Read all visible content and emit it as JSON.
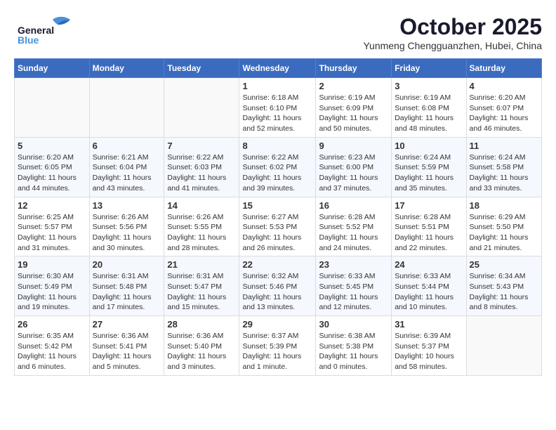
{
  "header": {
    "logo_general": "General",
    "logo_blue": "Blue",
    "month": "October 2025",
    "location": "Yunmeng Chengguanzhen, Hubei, China"
  },
  "weekdays": [
    "Sunday",
    "Monday",
    "Tuesday",
    "Wednesday",
    "Thursday",
    "Friday",
    "Saturday"
  ],
  "weeks": [
    [
      {
        "day": "",
        "info": ""
      },
      {
        "day": "",
        "info": ""
      },
      {
        "day": "",
        "info": ""
      },
      {
        "day": "1",
        "info": "Sunrise: 6:18 AM\nSunset: 6:10 PM\nDaylight: 11 hours\nand 52 minutes."
      },
      {
        "day": "2",
        "info": "Sunrise: 6:19 AM\nSunset: 6:09 PM\nDaylight: 11 hours\nand 50 minutes."
      },
      {
        "day": "3",
        "info": "Sunrise: 6:19 AM\nSunset: 6:08 PM\nDaylight: 11 hours\nand 48 minutes."
      },
      {
        "day": "4",
        "info": "Sunrise: 6:20 AM\nSunset: 6:07 PM\nDaylight: 11 hours\nand 46 minutes."
      }
    ],
    [
      {
        "day": "5",
        "info": "Sunrise: 6:20 AM\nSunset: 6:05 PM\nDaylight: 11 hours\nand 44 minutes."
      },
      {
        "day": "6",
        "info": "Sunrise: 6:21 AM\nSunset: 6:04 PM\nDaylight: 11 hours\nand 43 minutes."
      },
      {
        "day": "7",
        "info": "Sunrise: 6:22 AM\nSunset: 6:03 PM\nDaylight: 11 hours\nand 41 minutes."
      },
      {
        "day": "8",
        "info": "Sunrise: 6:22 AM\nSunset: 6:02 PM\nDaylight: 11 hours\nand 39 minutes."
      },
      {
        "day": "9",
        "info": "Sunrise: 6:23 AM\nSunset: 6:00 PM\nDaylight: 11 hours\nand 37 minutes."
      },
      {
        "day": "10",
        "info": "Sunrise: 6:24 AM\nSunset: 5:59 PM\nDaylight: 11 hours\nand 35 minutes."
      },
      {
        "day": "11",
        "info": "Sunrise: 6:24 AM\nSunset: 5:58 PM\nDaylight: 11 hours\nand 33 minutes."
      }
    ],
    [
      {
        "day": "12",
        "info": "Sunrise: 6:25 AM\nSunset: 5:57 PM\nDaylight: 11 hours\nand 31 minutes."
      },
      {
        "day": "13",
        "info": "Sunrise: 6:26 AM\nSunset: 5:56 PM\nDaylight: 11 hours\nand 30 minutes."
      },
      {
        "day": "14",
        "info": "Sunrise: 6:26 AM\nSunset: 5:55 PM\nDaylight: 11 hours\nand 28 minutes."
      },
      {
        "day": "15",
        "info": "Sunrise: 6:27 AM\nSunset: 5:53 PM\nDaylight: 11 hours\nand 26 minutes."
      },
      {
        "day": "16",
        "info": "Sunrise: 6:28 AM\nSunset: 5:52 PM\nDaylight: 11 hours\nand 24 minutes."
      },
      {
        "day": "17",
        "info": "Sunrise: 6:28 AM\nSunset: 5:51 PM\nDaylight: 11 hours\nand 22 minutes."
      },
      {
        "day": "18",
        "info": "Sunrise: 6:29 AM\nSunset: 5:50 PM\nDaylight: 11 hours\nand 21 minutes."
      }
    ],
    [
      {
        "day": "19",
        "info": "Sunrise: 6:30 AM\nSunset: 5:49 PM\nDaylight: 11 hours\nand 19 minutes."
      },
      {
        "day": "20",
        "info": "Sunrise: 6:31 AM\nSunset: 5:48 PM\nDaylight: 11 hours\nand 17 minutes."
      },
      {
        "day": "21",
        "info": "Sunrise: 6:31 AM\nSunset: 5:47 PM\nDaylight: 11 hours\nand 15 minutes."
      },
      {
        "day": "22",
        "info": "Sunrise: 6:32 AM\nSunset: 5:46 PM\nDaylight: 11 hours\nand 13 minutes."
      },
      {
        "day": "23",
        "info": "Sunrise: 6:33 AM\nSunset: 5:45 PM\nDaylight: 11 hours\nand 12 minutes."
      },
      {
        "day": "24",
        "info": "Sunrise: 6:33 AM\nSunset: 5:44 PM\nDaylight: 11 hours\nand 10 minutes."
      },
      {
        "day": "25",
        "info": "Sunrise: 6:34 AM\nSunset: 5:43 PM\nDaylight: 11 hours\nand 8 minutes."
      }
    ],
    [
      {
        "day": "26",
        "info": "Sunrise: 6:35 AM\nSunset: 5:42 PM\nDaylight: 11 hours\nand 6 minutes."
      },
      {
        "day": "27",
        "info": "Sunrise: 6:36 AM\nSunset: 5:41 PM\nDaylight: 11 hours\nand 5 minutes."
      },
      {
        "day": "28",
        "info": "Sunrise: 6:36 AM\nSunset: 5:40 PM\nDaylight: 11 hours\nand 3 minutes."
      },
      {
        "day": "29",
        "info": "Sunrise: 6:37 AM\nSunset: 5:39 PM\nDaylight: 11 hours\nand 1 minute."
      },
      {
        "day": "30",
        "info": "Sunrise: 6:38 AM\nSunset: 5:38 PM\nDaylight: 11 hours\nand 0 minutes."
      },
      {
        "day": "31",
        "info": "Sunrise: 6:39 AM\nSunset: 5:37 PM\nDaylight: 10 hours\nand 58 minutes."
      },
      {
        "day": "",
        "info": ""
      }
    ]
  ]
}
